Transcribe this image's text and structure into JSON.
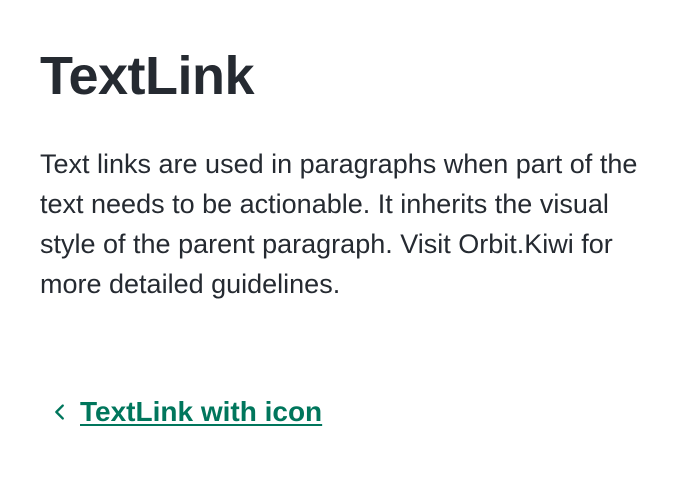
{
  "page": {
    "title": "TextLink",
    "description": "Text links are used in paragraphs when part of the text needs to be actionable. It inherits the visual style of the parent paragraph. Visit Orbit.Kiwi for more detailed guidelines."
  },
  "textlink": {
    "label": "TextLink with icon",
    "icon": "chevron-left-icon"
  },
  "colors": {
    "text": "#252a31",
    "link": "#00765c",
    "background": "#ffffff"
  }
}
